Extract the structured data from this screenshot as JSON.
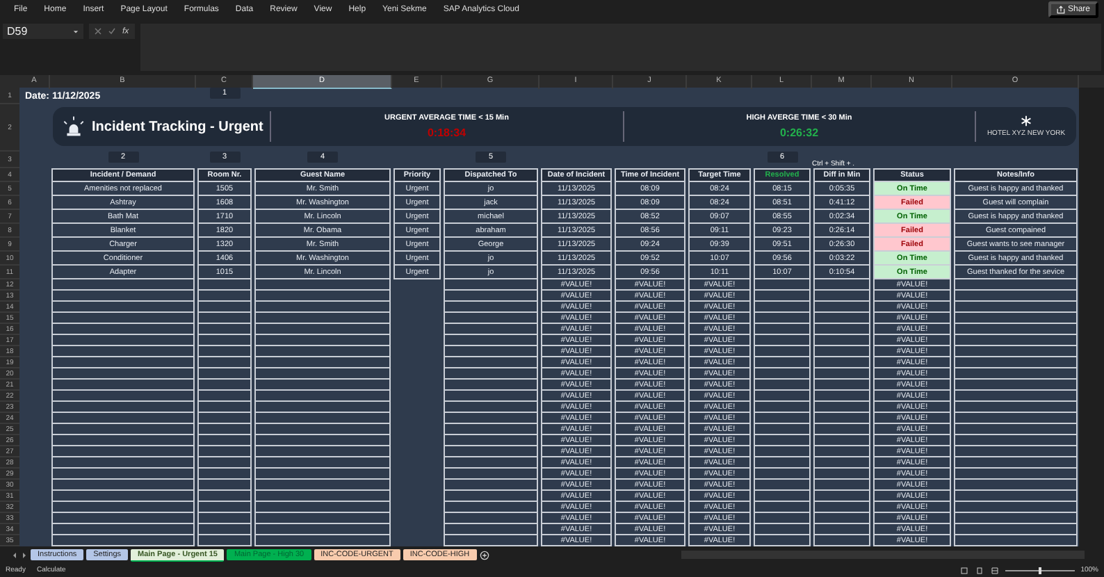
{
  "menu": [
    "File",
    "Home",
    "Insert",
    "Page Layout",
    "Formulas",
    "Data",
    "Review",
    "View",
    "Help",
    "Yeni Sekme",
    "SAP Analytics Cloud"
  ],
  "share": "Share",
  "formula_bar": {
    "name_box": "D59",
    "fx": "fx"
  },
  "columns": [
    {
      "letter": "A",
      "selected": false
    },
    {
      "letter": "B",
      "selected": false
    },
    {
      "letter": "C",
      "selected": false
    },
    {
      "letter": "D",
      "selected": true
    },
    {
      "letter": "E",
      "selected": false
    },
    {
      "letter": "G",
      "selected": false
    },
    {
      "letter": "I",
      "selected": false
    },
    {
      "letter": "J",
      "selected": false
    },
    {
      "letter": "K",
      "selected": false
    },
    {
      "letter": "L",
      "selected": false
    },
    {
      "letter": "M",
      "selected": false
    },
    {
      "letter": "N",
      "selected": false
    },
    {
      "letter": "O",
      "selected": false
    }
  ],
  "row_headers": [
    "1",
    "2",
    "3",
    "4",
    "5",
    "6",
    "7",
    "8",
    "9",
    "10",
    "11",
    "12",
    "13",
    "14",
    "15",
    "16",
    "17",
    "18",
    "19",
    "20",
    "21",
    "22",
    "23",
    "24",
    "25",
    "26",
    "27",
    "28",
    "29",
    "30",
    "31",
    "32",
    "33",
    "34",
    "35"
  ],
  "date_label": "Date: 11/12/2025",
  "markers": [
    {
      "label": "1"
    },
    {
      "label": "2"
    },
    {
      "label": "3"
    },
    {
      "label": "4"
    },
    {
      "label": "5"
    },
    {
      "label": "6"
    }
  ],
  "shortcut_hint": "Ctrl + Shift + .",
  "banner": {
    "title": "Incident Tracking - Urgent",
    "urgent_label": "URGENT AVERAGE TIME < 15 Min",
    "urgent_time": "0:18:34",
    "high_label": "HIGH AVERGE TIME < 30 Min",
    "high_time": "0:26:32",
    "logo_text": "HOTEL XYZ NEW YORK"
  },
  "table": {
    "columns": [
      {
        "label": "Incident / Demand",
        "kind": "plain"
      },
      {
        "label": "Room Nr.",
        "kind": "plain"
      },
      {
        "label": "Guest Name",
        "kind": "plain"
      },
      {
        "label": "Priority",
        "kind": "plain"
      },
      {
        "label": "Dispatched To",
        "kind": "plain"
      },
      {
        "label": "Date of Incident",
        "kind": "plain"
      },
      {
        "label": "Time of Incident",
        "kind": "plain"
      },
      {
        "label": "Target Time",
        "kind": "plain"
      },
      {
        "label": "Resolved",
        "kind": "accent"
      },
      {
        "label": "Diff in Min",
        "kind": "plain"
      },
      {
        "label": "Status",
        "kind": "plain"
      },
      {
        "label": "Notes/Info",
        "kind": "plain"
      }
    ],
    "rows": [
      {
        "incident": "Amenities not replaced",
        "room": "1505",
        "guest": "Mr. Smith",
        "priority": "Urgent",
        "dispatched": "jo",
        "date": "11/13/2025",
        "time": "08:09",
        "target": "08:24",
        "resolved": "08:15",
        "diff": "0:05:35",
        "status": "On Time",
        "on_time": true,
        "notes": "Guest is happy and thanked"
      },
      {
        "incident": "Ashtray",
        "room": "1608",
        "guest": "Mr. Washington",
        "priority": "Urgent",
        "dispatched": "jack",
        "date": "11/13/2025",
        "time": "08:09",
        "target": "08:24",
        "resolved": "08:51",
        "diff": "0:41:12",
        "status": "Failed",
        "on_time": false,
        "notes": "Guest will complain"
      },
      {
        "incident": "Bath Mat",
        "room": "1710",
        "guest": "Mr. Lincoln",
        "priority": "Urgent",
        "dispatched": "michael",
        "date": "11/13/2025",
        "time": "08:52",
        "target": "09:07",
        "resolved": "08:55",
        "diff": "0:02:34",
        "status": "On Time",
        "on_time": true,
        "notes": "Guest is happy and thanked"
      },
      {
        "incident": "Blanket",
        "room": "1820",
        "guest": "Mr. Obama",
        "priority": "Urgent",
        "dispatched": "abraham",
        "date": "11/13/2025",
        "time": "08:56",
        "target": "09:11",
        "resolved": "09:23",
        "diff": "0:26:14",
        "status": "Failed",
        "on_time": false,
        "notes": "Guest compained"
      },
      {
        "incident": "Charger",
        "room": "1320",
        "guest": "Mr. Smith",
        "priority": "Urgent",
        "dispatched": "George",
        "date": "11/13/2025",
        "time": "09:24",
        "target": "09:39",
        "resolved": "09:51",
        "diff": "0:26:30",
        "status": "Failed",
        "on_time": false,
        "notes": "Guest wants to see manager"
      },
      {
        "incident": "Conditioner",
        "room": "1406",
        "guest": "Mr. Washington",
        "priority": "Urgent",
        "dispatched": "jo",
        "date": "11/13/2025",
        "time": "09:52",
        "target": "10:07",
        "resolved": "09:56",
        "diff": "0:03:22",
        "status": "On Time",
        "on_time": true,
        "notes": "Guest is happy and thanked"
      },
      {
        "incident": "Adapter",
        "room": "1015",
        "guest": "Mr. Lincoln",
        "priority": "Urgent",
        "dispatched": "jo",
        "date": "11/13/2025",
        "time": "09:56",
        "target": "10:11",
        "resolved": "10:07",
        "diff": "0:10:54",
        "status": "On Time",
        "on_time": true,
        "notes": "Guest thanked for the sevice"
      },
      {
        "date": "#VALUE!",
        "time": "#VALUE!",
        "target": "#VALUE!",
        "status": "#VALUE!"
      },
      {
        "date": "#VALUE!",
        "time": "#VALUE!",
        "target": "#VALUE!",
        "status": "#VALUE!"
      },
      {
        "date": "#VALUE!",
        "time": "#VALUE!",
        "target": "#VALUE!",
        "status": "#VALUE!"
      },
      {
        "date": "#VALUE!",
        "time": "#VALUE!",
        "target": "#VALUE!",
        "status": "#VALUE!"
      },
      {
        "date": "#VALUE!",
        "time": "#VALUE!",
        "target": "#VALUE!",
        "status": "#VALUE!"
      },
      {
        "date": "#VALUE!",
        "time": "#VALUE!",
        "target": "#VALUE!",
        "status": "#VALUE!"
      },
      {
        "date": "#VALUE!",
        "time": "#VALUE!",
        "target": "#VALUE!",
        "status": "#VALUE!"
      },
      {
        "date": "#VALUE!",
        "time": "#VALUE!",
        "target": "#VALUE!",
        "status": "#VALUE!"
      },
      {
        "date": "#VALUE!",
        "time": "#VALUE!",
        "target": "#VALUE!",
        "status": "#VALUE!"
      },
      {
        "date": "#VALUE!",
        "time": "#VALUE!",
        "target": "#VALUE!",
        "status": "#VALUE!"
      },
      {
        "date": "#VALUE!",
        "time": "#VALUE!",
        "target": "#VALUE!",
        "status": "#VALUE!"
      },
      {
        "date": "#VALUE!",
        "time": "#VALUE!",
        "target": "#VALUE!",
        "status": "#VALUE!"
      },
      {
        "date": "#VALUE!",
        "time": "#VALUE!",
        "target": "#VALUE!",
        "status": "#VALUE!"
      },
      {
        "date": "#VALUE!",
        "time": "#VALUE!",
        "target": "#VALUE!",
        "status": "#VALUE!"
      },
      {
        "date": "#VALUE!",
        "time": "#VALUE!",
        "target": "#VALUE!",
        "status": "#VALUE!"
      },
      {
        "date": "#VALUE!",
        "time": "#VALUE!",
        "target": "#VALUE!",
        "status": "#VALUE!"
      },
      {
        "date": "#VALUE!",
        "time": "#VALUE!",
        "target": "#VALUE!",
        "status": "#VALUE!"
      },
      {
        "date": "#VALUE!",
        "time": "#VALUE!",
        "target": "#VALUE!",
        "status": "#VALUE!"
      },
      {
        "date": "#VALUE!",
        "time": "#VALUE!",
        "target": "#VALUE!",
        "status": "#VALUE!"
      },
      {
        "date": "#VALUE!",
        "time": "#VALUE!",
        "target": "#VALUE!",
        "status": "#VALUE!"
      },
      {
        "date": "#VALUE!",
        "time": "#VALUE!",
        "target": "#VALUE!",
        "status": "#VALUE!"
      },
      {
        "date": "#VALUE!",
        "time": "#VALUE!",
        "target": "#VALUE!",
        "status": "#VALUE!"
      },
      {
        "date": "#VALUE!",
        "time": "#VALUE!",
        "target": "#VALUE!",
        "status": "#VALUE!"
      },
      {
        "date": "#VALUE!",
        "time": "#VALUE!",
        "target": "#VALUE!",
        "status": "#VALUE!"
      }
    ]
  },
  "sheet_tabs": [
    {
      "label": "Instructions",
      "kind": "blue",
      "selected": false
    },
    {
      "label": "Settings",
      "kind": "blue",
      "selected": false
    },
    {
      "label": "Main Page - Urgent 15",
      "kind": "green",
      "selected": true
    },
    {
      "label": "Main Page - High 30",
      "kind": "green",
      "selected": false
    },
    {
      "label": "INC-CODE-URGENT",
      "kind": "peach",
      "selected": false
    },
    {
      "label": "INC-CODE-HIGH",
      "kind": "peach",
      "selected": false
    }
  ],
  "status_bar": {
    "ready": "Ready",
    "calculate": "Calculate",
    "zoom": {
      "level": 0.5,
      "label": "100%"
    }
  }
}
